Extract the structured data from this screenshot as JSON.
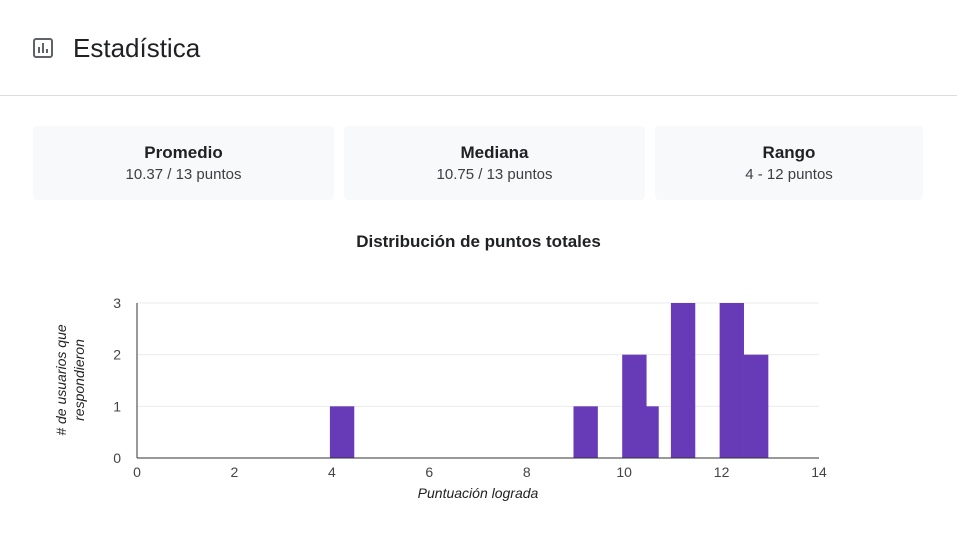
{
  "header": {
    "title": "Estadística",
    "icon": "bar-chart-icon"
  },
  "stats": [
    {
      "label": "Promedio",
      "value": "10.37 / 13 puntos"
    },
    {
      "label": "Mediana",
      "value": "10.75 / 13 puntos"
    },
    {
      "label": "Rango",
      "value": "4 - 12 puntos"
    }
  ],
  "colors": {
    "bar": "#673ab7",
    "grid": "#ebebeb",
    "axis": "#333333"
  },
  "chart_data": {
    "type": "bar",
    "title": "Distribución de puntos totales",
    "xlabel": "Puntuación lograda",
    "ylabel": "# de usuarios que respondieron",
    "xlim": [
      0,
      14
    ],
    "ylim": [
      0,
      3
    ],
    "x_ticks": [
      "0",
      "2",
      "4",
      "6",
      "8",
      "10",
      "12",
      "14"
    ],
    "y_ticks": [
      "0",
      "1",
      "2",
      "3"
    ],
    "grid": true,
    "legend": "none",
    "bin_width": 0.5,
    "bins": [
      {
        "x": 4,
        "count": 1
      },
      {
        "x": 9,
        "count": 1
      },
      {
        "x": 10,
        "count": 2
      },
      {
        "x": 10.25,
        "count": 1
      },
      {
        "x": 11,
        "count": 3
      },
      {
        "x": 12,
        "count": 3
      },
      {
        "x": 12.5,
        "count": 2
      }
    ]
  }
}
